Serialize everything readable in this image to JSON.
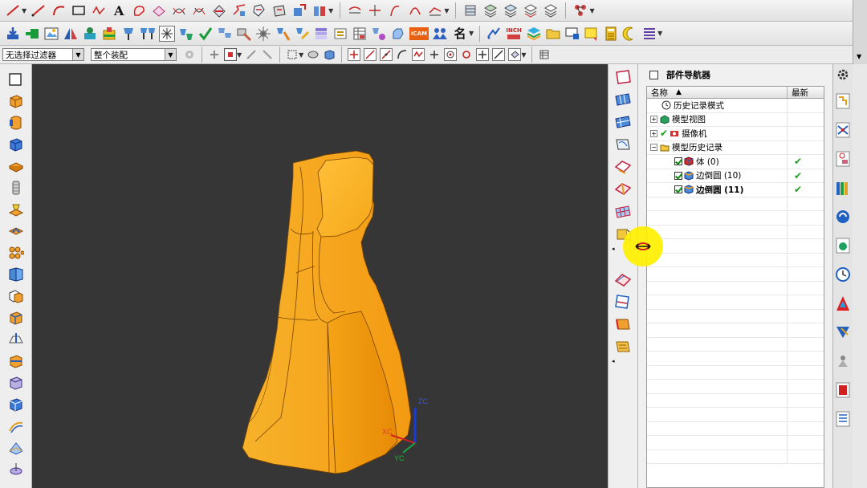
{
  "toolbar1": {
    "groups": [
      [
        "line-icon",
        "dropdown",
        "line-icon",
        "arc-icon",
        "rectangle-icon",
        "spline-icon",
        "text-icon",
        "offset-curve-icon",
        "project-curve-icon",
        "intersect-curve-icon",
        "isoparametric-curve-icon",
        "extract-curve-icon",
        "bridge-curve-icon",
        "curve-on-surface-icon",
        "wrap-icon",
        "join-curve-icon",
        "dropdown"
      ],
      [
        "trim-curve-icon",
        "divide-curve-icon",
        "stretch-curve-icon",
        "edit-curve-icon",
        "curve-length-icon",
        "dropdown"
      ],
      [
        "layer-icon",
        "layer-settings-icon",
        "layer-copy-icon",
        "layer-move-icon",
        "layer-visible-icon"
      ],
      [
        "snap-icon",
        "dropdown"
      ]
    ]
  },
  "toolbar2": {
    "cam_label": "iCAM",
    "name_label": "名",
    "inch_label": "INCH"
  },
  "selection_bar": {
    "filter": "无选择过滤器",
    "scope": "整个装配"
  },
  "navigator": {
    "title": "部件导航器",
    "col_name": "名称",
    "col_latest": "最新",
    "rows": [
      {
        "indent": 1,
        "expander": "",
        "check": false,
        "icon": "clock-icon",
        "label": "历史记录模式",
        "latest": "",
        "bold": false
      },
      {
        "indent": 0,
        "expander": "+",
        "check": false,
        "icon": "model-view-icon",
        "label": "模型视图",
        "latest": "",
        "bold": false
      },
      {
        "indent": 0,
        "expander": "+",
        "check": false,
        "icon": "camera-icon",
        "label": "摄像机",
        "latest": "",
        "bold": false,
        "green": true
      },
      {
        "indent": 0,
        "expander": "−",
        "check": false,
        "icon": "folder-icon",
        "label": "模型历史记录",
        "latest": "",
        "bold": false
      },
      {
        "indent": 2,
        "expander": "",
        "check": true,
        "icon": "body-icon",
        "label": "体 (0)",
        "latest": "✔",
        "bold": false
      },
      {
        "indent": 2,
        "expander": "",
        "check": true,
        "icon": "blend-icon",
        "label": "边倒圆 (10)",
        "latest": "✔",
        "bold": false
      },
      {
        "indent": 2,
        "expander": "",
        "check": true,
        "icon": "blend-icon",
        "label": "边倒圆 (11)",
        "latest": "✔",
        "bold": true
      }
    ]
  },
  "viewport": {
    "background": "#363636",
    "model_color": "#f5a41d",
    "axes": {
      "x": "XC",
      "y": "YC",
      "z": "ZC"
    }
  }
}
